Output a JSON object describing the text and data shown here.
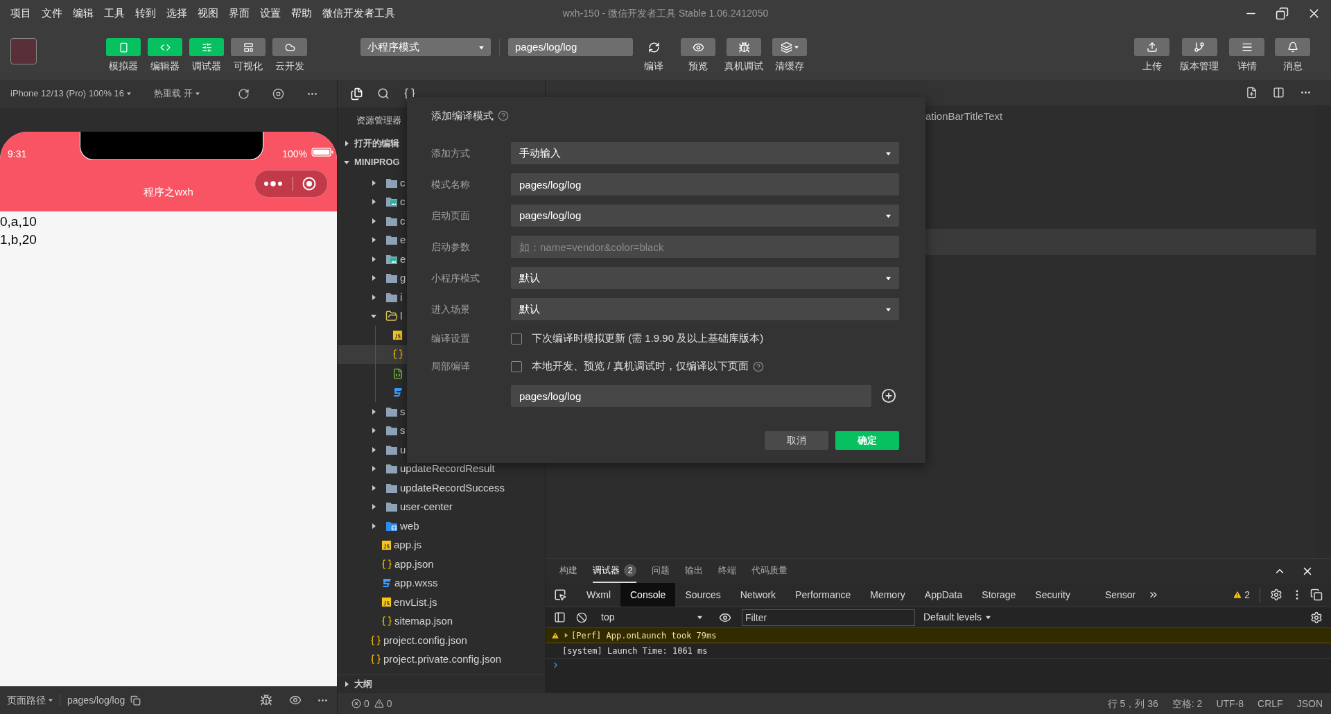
{
  "menu_bar": {
    "items": [
      "项目",
      "文件",
      "编辑",
      "工具",
      "转到",
      "选择",
      "视图",
      "界面",
      "设置",
      "帮助",
      "微信开发者工具"
    ],
    "title": "wxh-150 - 微信开发者工具 Stable 1.06.2412050"
  },
  "toolbar": {
    "view_toggles": [
      {
        "kind": "simulator",
        "label": "模拟器",
        "on": true
      },
      {
        "kind": "editor",
        "label": "编辑器",
        "on": true
      },
      {
        "kind": "debugger",
        "label": "调试器",
        "on": true
      },
      {
        "kind": "visual",
        "label": "可视化",
        "on": false
      },
      {
        "kind": "cloud",
        "label": "云开发",
        "on": false
      }
    ],
    "mode_select": {
      "value": "小程序模式"
    },
    "compile_select": {
      "value": "pages/log/log"
    },
    "actions": [
      {
        "kind": "compile",
        "label": "编译"
      },
      {
        "kind": "preview",
        "label": "预览"
      },
      {
        "kind": "remote-debug",
        "label": "真机调试"
      },
      {
        "kind": "clear-cache",
        "label": "清缓存"
      }
    ],
    "right_actions": [
      {
        "kind": "upload",
        "label": "上传"
      },
      {
        "kind": "version",
        "label": "版本管理"
      },
      {
        "kind": "details",
        "label": "详情"
      },
      {
        "kind": "messages",
        "label": "消息"
      }
    ]
  },
  "simulator": {
    "device": "iPhone 12/13 (Pro) 100% 16",
    "hot_reload": "热重载 开",
    "time": "9:31",
    "battery": "100%",
    "nav_title": "程序之wxh",
    "content_lines": [
      "0,a,10",
      "1,b,20"
    ],
    "page_path_label": "页面路径",
    "page_path": "pages/log/log"
  },
  "explorer": {
    "title": "资源管理器",
    "open_editors": {
      "label": "打开的编辑",
      "expanded": false
    },
    "project": {
      "label": "MINIPROG",
      "expanded": true,
      "children": [
        {
          "kind": "folder",
          "name": "c",
          "expanded": false,
          "selected": false
        },
        {
          "kind": "image-folder",
          "name": "c",
          "expanded": false,
          "selected": false
        },
        {
          "kind": "folder",
          "name": "c",
          "expanded": false,
          "selected": false
        },
        {
          "kind": "folder",
          "name": "e",
          "expanded": false,
          "selected": false
        },
        {
          "kind": "image-folder",
          "name": "e",
          "expanded": false,
          "selected": false
        },
        {
          "kind": "folder",
          "name": "g",
          "expanded": false,
          "selected": false
        },
        {
          "kind": "folder",
          "name": "i",
          "expanded": false,
          "selected": false
        },
        {
          "kind": "folder",
          "name": "l",
          "expanded": true,
          "selected": false,
          "children": [
            {
              "kind": "js",
              "selected": false
            },
            {
              "kind": "json",
              "selected": true
            },
            {
              "kind": "wxml",
              "selected": false
            },
            {
              "kind": "wxss",
              "selected": false
            }
          ]
        },
        {
          "kind": "folder",
          "name": "s",
          "expanded": false,
          "selected": false
        },
        {
          "kind": "folder",
          "name": "s",
          "expanded": false,
          "selected": false
        },
        {
          "kind": "folder",
          "name": "u",
          "expanded": false,
          "selected": false
        },
        {
          "kind": "folder",
          "name": "updateRecordResult",
          "expanded": false,
          "selected": false
        },
        {
          "kind": "folder",
          "name": "updateRecordSuccess",
          "expanded": false,
          "selected": false
        },
        {
          "kind": "folder",
          "name": "user-center",
          "expanded": false,
          "selected": false
        },
        {
          "kind": "web-folder",
          "name": "web",
          "expanded": false,
          "selected": false
        },
        {
          "kind": "js",
          "name": "app.js",
          "selected": false
        },
        {
          "kind": "json",
          "name": "app.json",
          "selected": false
        },
        {
          "kind": "wxss",
          "name": "app.wxss",
          "selected": false
        },
        {
          "kind": "js",
          "name": "envList.js",
          "selected": false
        },
        {
          "kind": "json",
          "name": "sitemap.json",
          "selected": false
        }
      ],
      "root_files": [
        {
          "kind": "json",
          "name": "project.config.json",
          "selected": false
        },
        {
          "kind": "json",
          "name": "project.private.config.json",
          "selected": false
        }
      ]
    },
    "outline": {
      "label": "大纲",
      "expanded": false
    },
    "problems": {
      "errors": "0",
      "warnings": "0"
    }
  },
  "dialog": {
    "title": "添加编译模式",
    "fields": [
      {
        "kind": "select",
        "label": "添加方式",
        "value": "手动输入"
      },
      {
        "kind": "text",
        "label": "模式名称",
        "value": "pages/log/log"
      },
      {
        "kind": "select",
        "label": "启动页面",
        "value": "pages/log/log"
      },
      {
        "kind": "text",
        "label": "启动参数",
        "placeholder": "如：name=vendor&color=black"
      },
      {
        "kind": "select",
        "label": "小程序模式",
        "value": "默认"
      },
      {
        "kind": "select",
        "label": "进入场景",
        "value": "默认"
      },
      {
        "kind": "checkbox",
        "label": "编译设置",
        "text": "下次编译时模拟更新 (需 1.9.90 及以上基础库版本)",
        "checked": false,
        "help": false
      },
      {
        "kind": "checkbox",
        "label": "局部编译",
        "text": "本地开发、预览 / 真机调试时，仅编译以下页面",
        "checked": false,
        "help": true
      }
    ],
    "page_list": [
      {
        "value": "pages/log/log"
      }
    ],
    "buttons": [
      {
        "kind": "cancel",
        "label": "取消"
      },
      {
        "kind": "confirm",
        "label": "确定"
      }
    ]
  },
  "editor": {
    "visible_text": "ationBarTitleText"
  },
  "panel": {
    "tabs": [
      {
        "label": "构建",
        "selected": false
      },
      {
        "label": "调试器",
        "selected": true,
        "badge": "2"
      },
      {
        "label": "问题",
        "selected": false
      },
      {
        "label": "输出",
        "selected": false
      },
      {
        "label": "终端",
        "selected": false
      },
      {
        "label": "代码质量",
        "selected": false
      }
    ],
    "devtools_tabs": [
      {
        "label": "Wxml",
        "selected": false
      },
      {
        "label": "Console",
        "selected": true
      },
      {
        "label": "Sources",
        "selected": false
      },
      {
        "label": "Network",
        "selected": false
      },
      {
        "label": "Performance",
        "selected": false
      },
      {
        "label": "Memory",
        "selected": false
      },
      {
        "label": "AppData",
        "selected": false
      },
      {
        "label": "Storage",
        "selected": false
      },
      {
        "label": "Security",
        "selected": false
      },
      {
        "label": "Sensor",
        "selected": false
      }
    ],
    "warning_count": "2",
    "console": {
      "context": "top",
      "filter_placeholder": "Filter",
      "levels": "Default levels",
      "messages": [
        {
          "kind": "warning",
          "text": "[Perf] App.onLaunch took 79ms"
        },
        {
          "kind": "log",
          "text": "[system] Launch Time: 1061 ms"
        }
      ]
    }
  },
  "status_bar": {
    "items": [
      "行 5，列 36",
      "空格: 2",
      "UTF-8",
      "CRLF",
      "JSON"
    ]
  }
}
